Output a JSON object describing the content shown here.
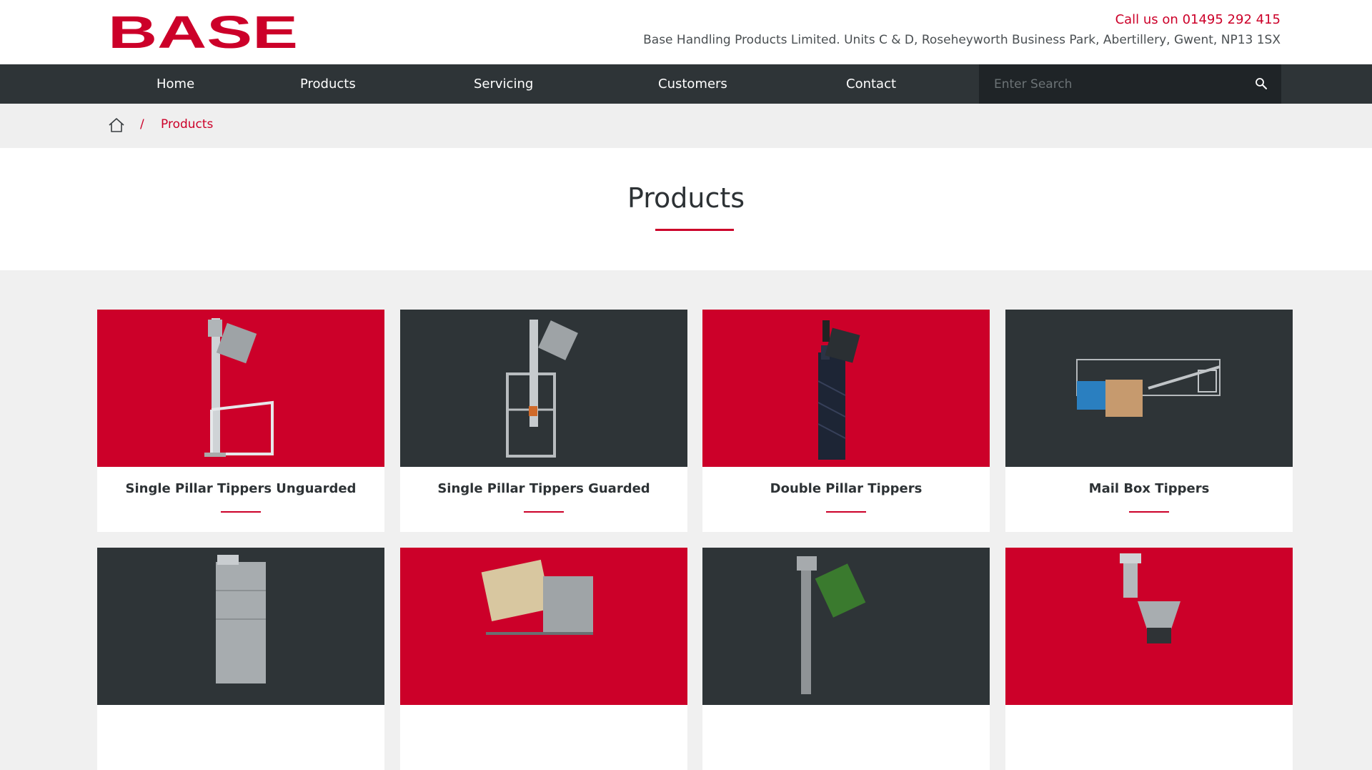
{
  "brand": {
    "logo_text": "BASE",
    "accent": "#cc0029",
    "dark": "#2e3437"
  },
  "header": {
    "call_prefix": "Call us on",
    "phone": "01495 292 415",
    "address": "Base Handling Products Limited. Units C & D, Roseheyworth Business Park, Abertillery, Gwent, NP13 1SX"
  },
  "nav": {
    "items": [
      {
        "label": "Home"
      },
      {
        "label": "Products"
      },
      {
        "label": "Servicing"
      },
      {
        "label": "Customers"
      },
      {
        "label": "Contact"
      }
    ],
    "search_placeholder": "Enter Search",
    "search_icon": "search-icon"
  },
  "breadcrumb": {
    "home_icon": "home-icon",
    "separator": "/",
    "current": "Products"
  },
  "page": {
    "title": "Products"
  },
  "products": [
    {
      "title": "Single Pillar Tippers Unguarded",
      "bg": "red"
    },
    {
      "title": "Single Pillar Tippers Guarded",
      "bg": "dark"
    },
    {
      "title": "Double Pillar Tippers",
      "bg": "red"
    },
    {
      "title": "Mail Box Tippers",
      "bg": "dark"
    },
    {
      "title": "",
      "bg": "dark"
    },
    {
      "title": "",
      "bg": "red"
    },
    {
      "title": "",
      "bg": "dark"
    },
    {
      "title": "",
      "bg": "red"
    }
  ]
}
